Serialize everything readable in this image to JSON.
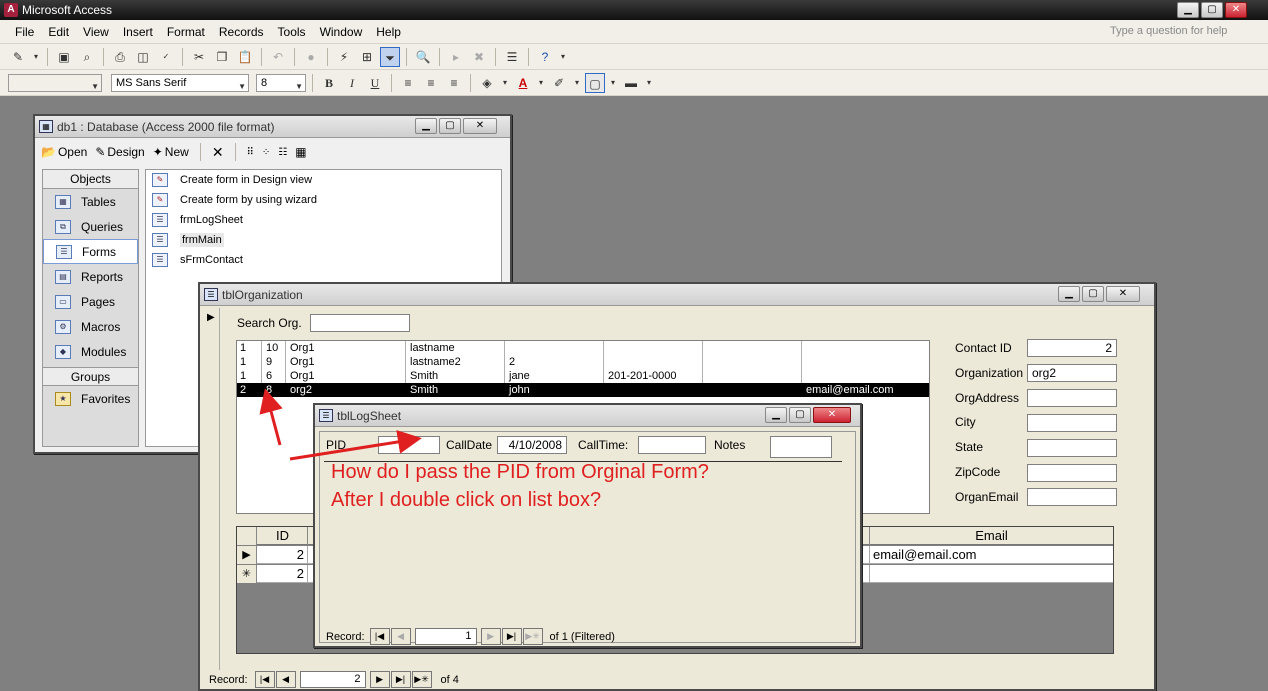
{
  "app": {
    "title": "Microsoft Access",
    "icon_letter": "A",
    "help_placeholder": "Type a question for help"
  },
  "menu": [
    "File",
    "Edit",
    "View",
    "Insert",
    "Format",
    "Records",
    "Tools",
    "Window",
    "Help"
  ],
  "toolbar2": {
    "object_combo": "",
    "font_combo": "MS Sans Serif",
    "size_combo": "8",
    "bold": "B",
    "italic": "I",
    "underline": "U"
  },
  "db_window": {
    "title": "db1 : Database (Access 2000 file format)",
    "toolbar": {
      "open": "Open",
      "design": "Design",
      "new": "New"
    },
    "objects_header": "Objects",
    "objects": [
      "Tables",
      "Queries",
      "Forms",
      "Reports",
      "Pages",
      "Macros",
      "Modules"
    ],
    "selected_object": "Forms",
    "groups_header": "Groups",
    "groups": [
      "Favorites"
    ],
    "list": [
      "Create form in Design view",
      "Create form by using wizard",
      "frmLogSheet",
      "frmMain",
      "sFrmContact"
    ]
  },
  "org_form": {
    "title": "tblOrganization",
    "search_label": "Search Org.",
    "search_value": "",
    "listbox_rows": [
      [
        "1",
        "10",
        "Org1",
        "lastname",
        "",
        "",
        "",
        ""
      ],
      [
        "1",
        "9",
        "Org1",
        "lastname2",
        "2",
        "",
        "",
        ""
      ],
      [
        "1",
        "6",
        "Org1",
        "Smith",
        "jane",
        "201-201-0000",
        "",
        ""
      ],
      [
        "2",
        "8",
        "org2",
        "Smith",
        "john",
        "",
        "",
        "email@email.com"
      ]
    ],
    "selected_row": 3,
    "fields": [
      {
        "label": "Contact ID",
        "value": "2",
        "align": "right"
      },
      {
        "label": "Organization",
        "value": "org2",
        "align": "left"
      },
      {
        "label": "OrgAddress",
        "value": "",
        "align": "left"
      },
      {
        "label": "City",
        "value": "",
        "align": "left"
      },
      {
        "label": "State",
        "value": "",
        "align": "left"
      },
      {
        "label": "ZipCode",
        "value": "",
        "align": "left"
      },
      {
        "label": "OrganEmail",
        "value": "",
        "align": "left"
      }
    ],
    "subgrid": {
      "headers": {
        "id": "ID",
        "email": "Email"
      },
      "rows": [
        {
          "selector": "▶",
          "id": "2",
          "email": "email@email.com"
        },
        {
          "selector": "✳",
          "id": "2",
          "email": ""
        }
      ]
    },
    "record_nav": {
      "label": "Record:",
      "current": "2",
      "of_text": "of 4"
    }
  },
  "log_form": {
    "title": "tblLogSheet",
    "pid_label": "PID",
    "pid_value": "",
    "calldate_label": "CallDate",
    "calldate_value": "4/10/2008",
    "calltime_label": "CallTime:",
    "calltime_value": "",
    "notes_label": "Notes",
    "notes_value": "",
    "record_nav": {
      "label": "Record:",
      "current": "1",
      "of_text": "of  1 (Filtered)"
    }
  },
  "annotation": {
    "line1": "How do I pass the PID from Orginal Form?",
    "line2": "After I double click on list box?",
    "color": "#e02020"
  }
}
